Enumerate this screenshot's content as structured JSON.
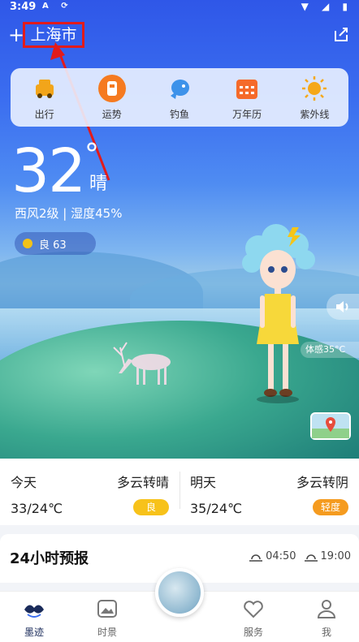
{
  "status_bar": {
    "time": "3:49",
    "left_icons": "A ⟳",
    "right_icons": "▼ ◢ ▮"
  },
  "header": {
    "city": "上海市"
  },
  "quick_actions": [
    {
      "label": "出行",
      "icon": "car-icon",
      "color": "#f2a51a"
    },
    {
      "label": "运势",
      "icon": "fortune-icon",
      "color": "#f57a20"
    },
    {
      "label": "钓鱼",
      "icon": "fish-icon",
      "color": "#3d92ea"
    },
    {
      "label": "万年历",
      "icon": "calendar-icon",
      "color": "#f56a2a"
    },
    {
      "label": "紫外线",
      "icon": "sun-icon",
      "color": "#f5a818"
    }
  ],
  "current": {
    "temp": "32",
    "degree": "°",
    "condition": "晴",
    "wind_humidity": "西风2级 | 湿度45%",
    "aqi": "良 63",
    "feels_like": "体感35°C"
  },
  "daily": [
    {
      "name": "今天",
      "condition": "多云转晴",
      "temp": "33/24℃",
      "aqi": "良",
      "aqi_color": "#f7c21a"
    },
    {
      "name": "明天",
      "condition": "多云转阴",
      "temp": "35/24℃",
      "aqi": "轻度",
      "aqi_color": "#f59b1f"
    }
  ],
  "hourly": {
    "title": "24小时预报",
    "sunrise": "04:50",
    "sunset": "19:00"
  },
  "tabs": [
    {
      "label": "墨迹",
      "icon": "moji-icon",
      "active": true
    },
    {
      "label": "时景",
      "icon": "photo-icon",
      "active": false
    },
    {
      "label": "服务",
      "icon": "service-icon",
      "active": false
    },
    {
      "label": "我",
      "icon": "profile-icon",
      "active": false
    }
  ],
  "colors": {
    "annotation": "#e21b1b",
    "accent_blue": "#3b6ef0"
  }
}
